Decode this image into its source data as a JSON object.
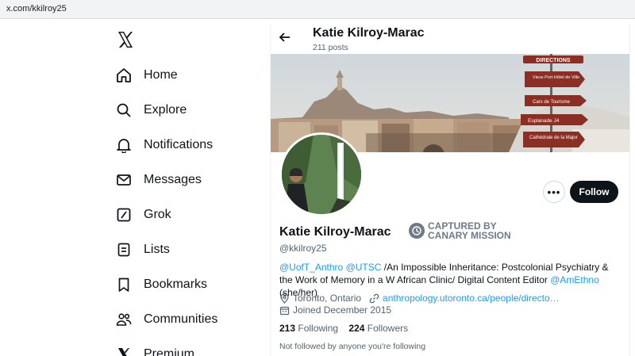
{
  "browser": {
    "url": "x.com/kkilroy25"
  },
  "nav": {
    "logo": "x-logo-icon",
    "items": [
      {
        "label": "Home",
        "icon": "home-icon"
      },
      {
        "label": "Explore",
        "icon": "search-icon"
      },
      {
        "label": "Notifications",
        "icon": "bell-icon"
      },
      {
        "label": "Messages",
        "icon": "envelope-icon"
      },
      {
        "label": "Grok",
        "icon": "grok-icon"
      },
      {
        "label": "Lists",
        "icon": "list-icon"
      },
      {
        "label": "Bookmarks",
        "icon": "bookmark-icon"
      },
      {
        "label": "Communities",
        "icon": "communities-icon"
      },
      {
        "label": "Premium",
        "icon": "x-premium-icon"
      }
    ]
  },
  "header": {
    "name": "Katie Kilroy-Marac",
    "posts": "211 posts"
  },
  "profile": {
    "name": "Katie Kilroy-Marac",
    "handle": "@kkilroy25",
    "badge_line1": "CAPTURED BY",
    "badge_line2": "CANARY MISSION",
    "bio": {
      "mention1": "@UofT_Anthro",
      "mention2": "@UTSC",
      "text1": " /An Impossible Inheritance: Postcolonial Psychiatry & the Work of Memory in a W African Clinic/ Digital Content Editor ",
      "mention3": "@AmEthno",
      "text2": " (she/her)"
    },
    "location": "Toronto, Ontario",
    "website": "anthropology.utoronto.ca/people/directo…",
    "joined": "Joined December 2015",
    "following_count": "213",
    "following_label": "Following",
    "followers_count": "224",
    "followers_label": "Followers",
    "not_followed": "Not followed by anyone you're following"
  },
  "actions": {
    "more": "•••",
    "follow": "Follow"
  },
  "banner_signs": [
    "DIRECTIONS",
    "Vieux Port Hôtel de Ville",
    "Cars de Tourisme",
    "Esplanade J4",
    "Cathédrale de la Major"
  ],
  "colors": {
    "accent": "#1d9bf0",
    "text": "#0f1419",
    "muted": "#536471"
  }
}
